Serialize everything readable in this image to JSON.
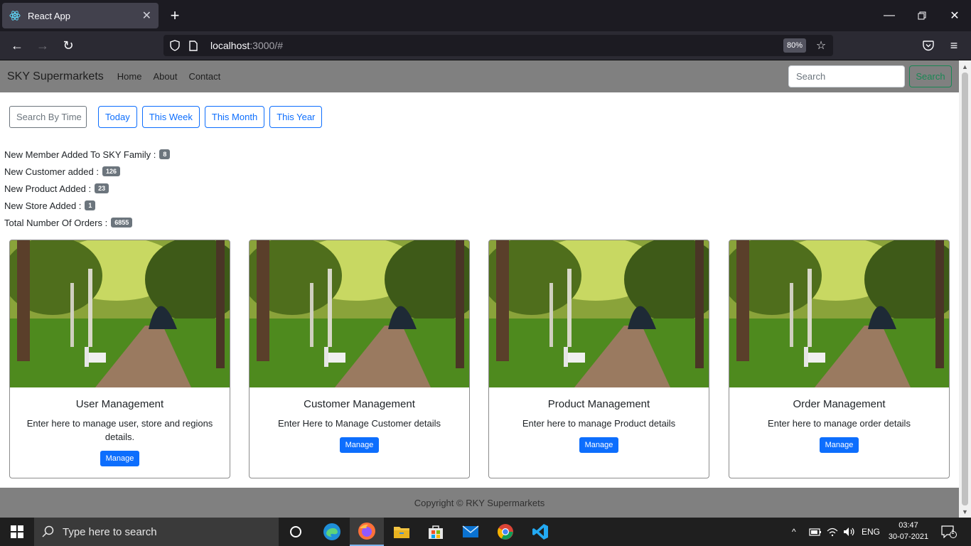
{
  "browser": {
    "tab_title": "React App",
    "url_host": "localhost",
    "url_rest": ":3000/#",
    "zoom": "80%"
  },
  "app": {
    "brand": "SKY Supermarkets",
    "nav": [
      "Home",
      "About",
      "Contact"
    ],
    "search_placeholder": "Search",
    "search_button": "Search"
  },
  "filters": {
    "time_placeholder": "Search By Time",
    "buttons": [
      "Today",
      "This Week",
      "This Month",
      "This Year"
    ]
  },
  "stats": [
    {
      "label": "New Member Added To SKY Family :",
      "value": "8"
    },
    {
      "label": "New Customer added :",
      "value": "126"
    },
    {
      "label": "New Product Added :",
      "value": "23"
    },
    {
      "label": "New Store Added :",
      "value": "1"
    },
    {
      "label": "Total Number Of Orders :",
      "value": "6855"
    }
  ],
  "cards": [
    {
      "title": "User Management",
      "text": "Enter here to manage user, store and regions details.",
      "button": "Manage"
    },
    {
      "title": "Customer Management",
      "text": "Enter Here to Manage Customer details",
      "button": "Manage"
    },
    {
      "title": "Product Management",
      "text": "Enter here to manage Product details",
      "button": "Manage"
    },
    {
      "title": "Order Management",
      "text": "Enter here to manage order details",
      "button": "Manage"
    }
  ],
  "footer": "Copyright © RKY Supermarkets",
  "taskbar": {
    "search_placeholder": "Type here to search",
    "language": "ENG",
    "time": "03:47",
    "date": "30-07-2021",
    "notifications": "1"
  },
  "colors": {
    "primary": "#0d6efd",
    "success": "#198754",
    "nav_gray": "#808080",
    "badge_gray": "#6c757d"
  }
}
